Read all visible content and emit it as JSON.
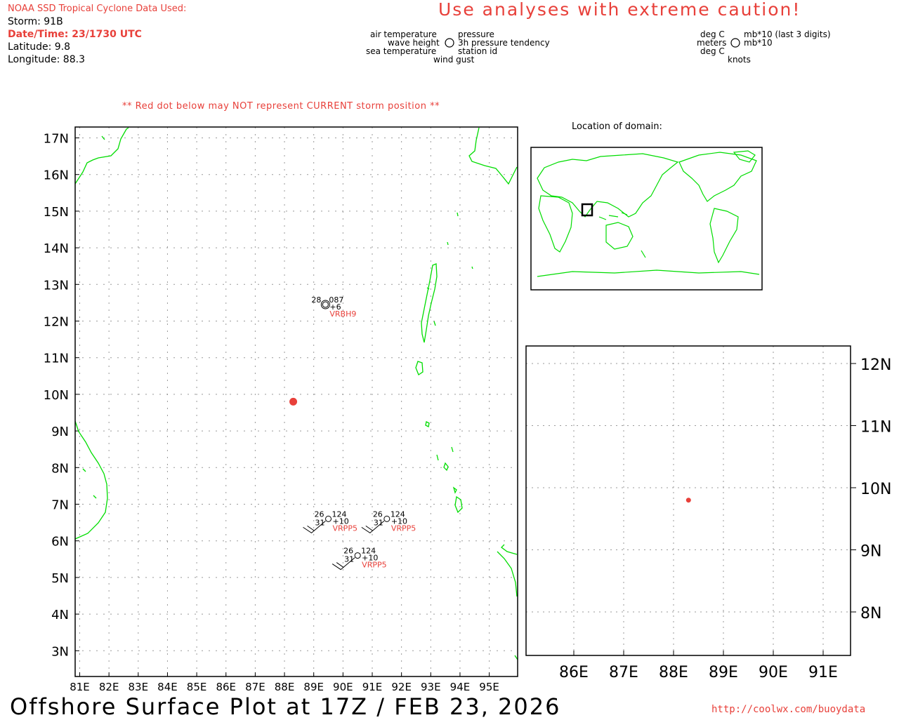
{
  "header": {
    "source": "NOAA SSD Tropical Cyclone Data Used:",
    "storm": "Storm: 91B",
    "datetime": "Date/Time: 23/1730 UTC",
    "latitude": "Latitude: 9.8",
    "longitude": "Longitude: 88.3"
  },
  "caution": "Use analyses with extreme caution!",
  "legend": {
    "air_temperature": "air temperature",
    "wave_height": "wave height",
    "sea_temperature": "sea temperature",
    "pressure": "pressure",
    "pressure_tendency": "3h pressure tendency",
    "station_id": "station id",
    "wind_gust": "wind gust",
    "unit_air": "deg C",
    "unit_wave": "meters",
    "unit_sea": "deg C",
    "unit_pressure": "mb*10 (last 3 digits)",
    "unit_tendency": "mb*10",
    "unit_wind": "knots"
  },
  "warning": "** Red dot below may NOT represent CURRENT storm position **",
  "inset_title": "Location of domain:",
  "main_map": {
    "lat_labels": [
      "17N",
      "16N",
      "15N",
      "14N",
      "13N",
      "12N",
      "11N",
      "10N",
      "9N",
      "8N",
      "7N",
      "6N",
      "5N",
      "4N",
      "3N"
    ],
    "lon_labels": [
      "81E",
      "82E",
      "83E",
      "84E",
      "85E",
      "86E",
      "87E",
      "88E",
      "89E",
      "90E",
      "91E",
      "92E",
      "93E",
      "94E",
      "95E"
    ],
    "storm_position": {
      "lat": 9.8,
      "lon": 88.3,
      "color": "#e8403a"
    },
    "stations": [
      {
        "id": "VRBH9",
        "air_temp": "28",
        "pressure": "087",
        "tendency": "+6",
        "sea_temp": "",
        "lat": 12.45,
        "lon": 89.4
      },
      {
        "id": "VRPP5",
        "air_temp": "26",
        "pressure": "124",
        "tendency": "+10",
        "sea_temp": "31",
        "lat": 6.6,
        "lon": 89.5
      },
      {
        "id": "VRPP5",
        "air_temp": "26",
        "pressure": "124",
        "tendency": "+10",
        "sea_temp": "31",
        "lat": 6.6,
        "lon": 91.5
      },
      {
        "id": "VRPP5",
        "air_temp": "26",
        "pressure": "124",
        "tendency": "+10",
        "sea_temp": "31",
        "lat": 5.6,
        "lon": 90.5
      }
    ]
  },
  "zoom_map": {
    "lat_labels": [
      "12N",
      "11N",
      "10N",
      "9N",
      "8N"
    ],
    "lon_labels": [
      "86E",
      "87E",
      "88E",
      "89E",
      "90E",
      "91E"
    ],
    "storm_position": {
      "lat": 9.8,
      "lon": 88.3
    }
  },
  "colors": {
    "land": "#00dd00",
    "accent": "#e8403a",
    "grid": "#999999"
  },
  "footer": {
    "title": "Offshore Surface Plot at 17Z / FEB 23, 2026",
    "url": "http://coolwx.com/buoydata"
  }
}
